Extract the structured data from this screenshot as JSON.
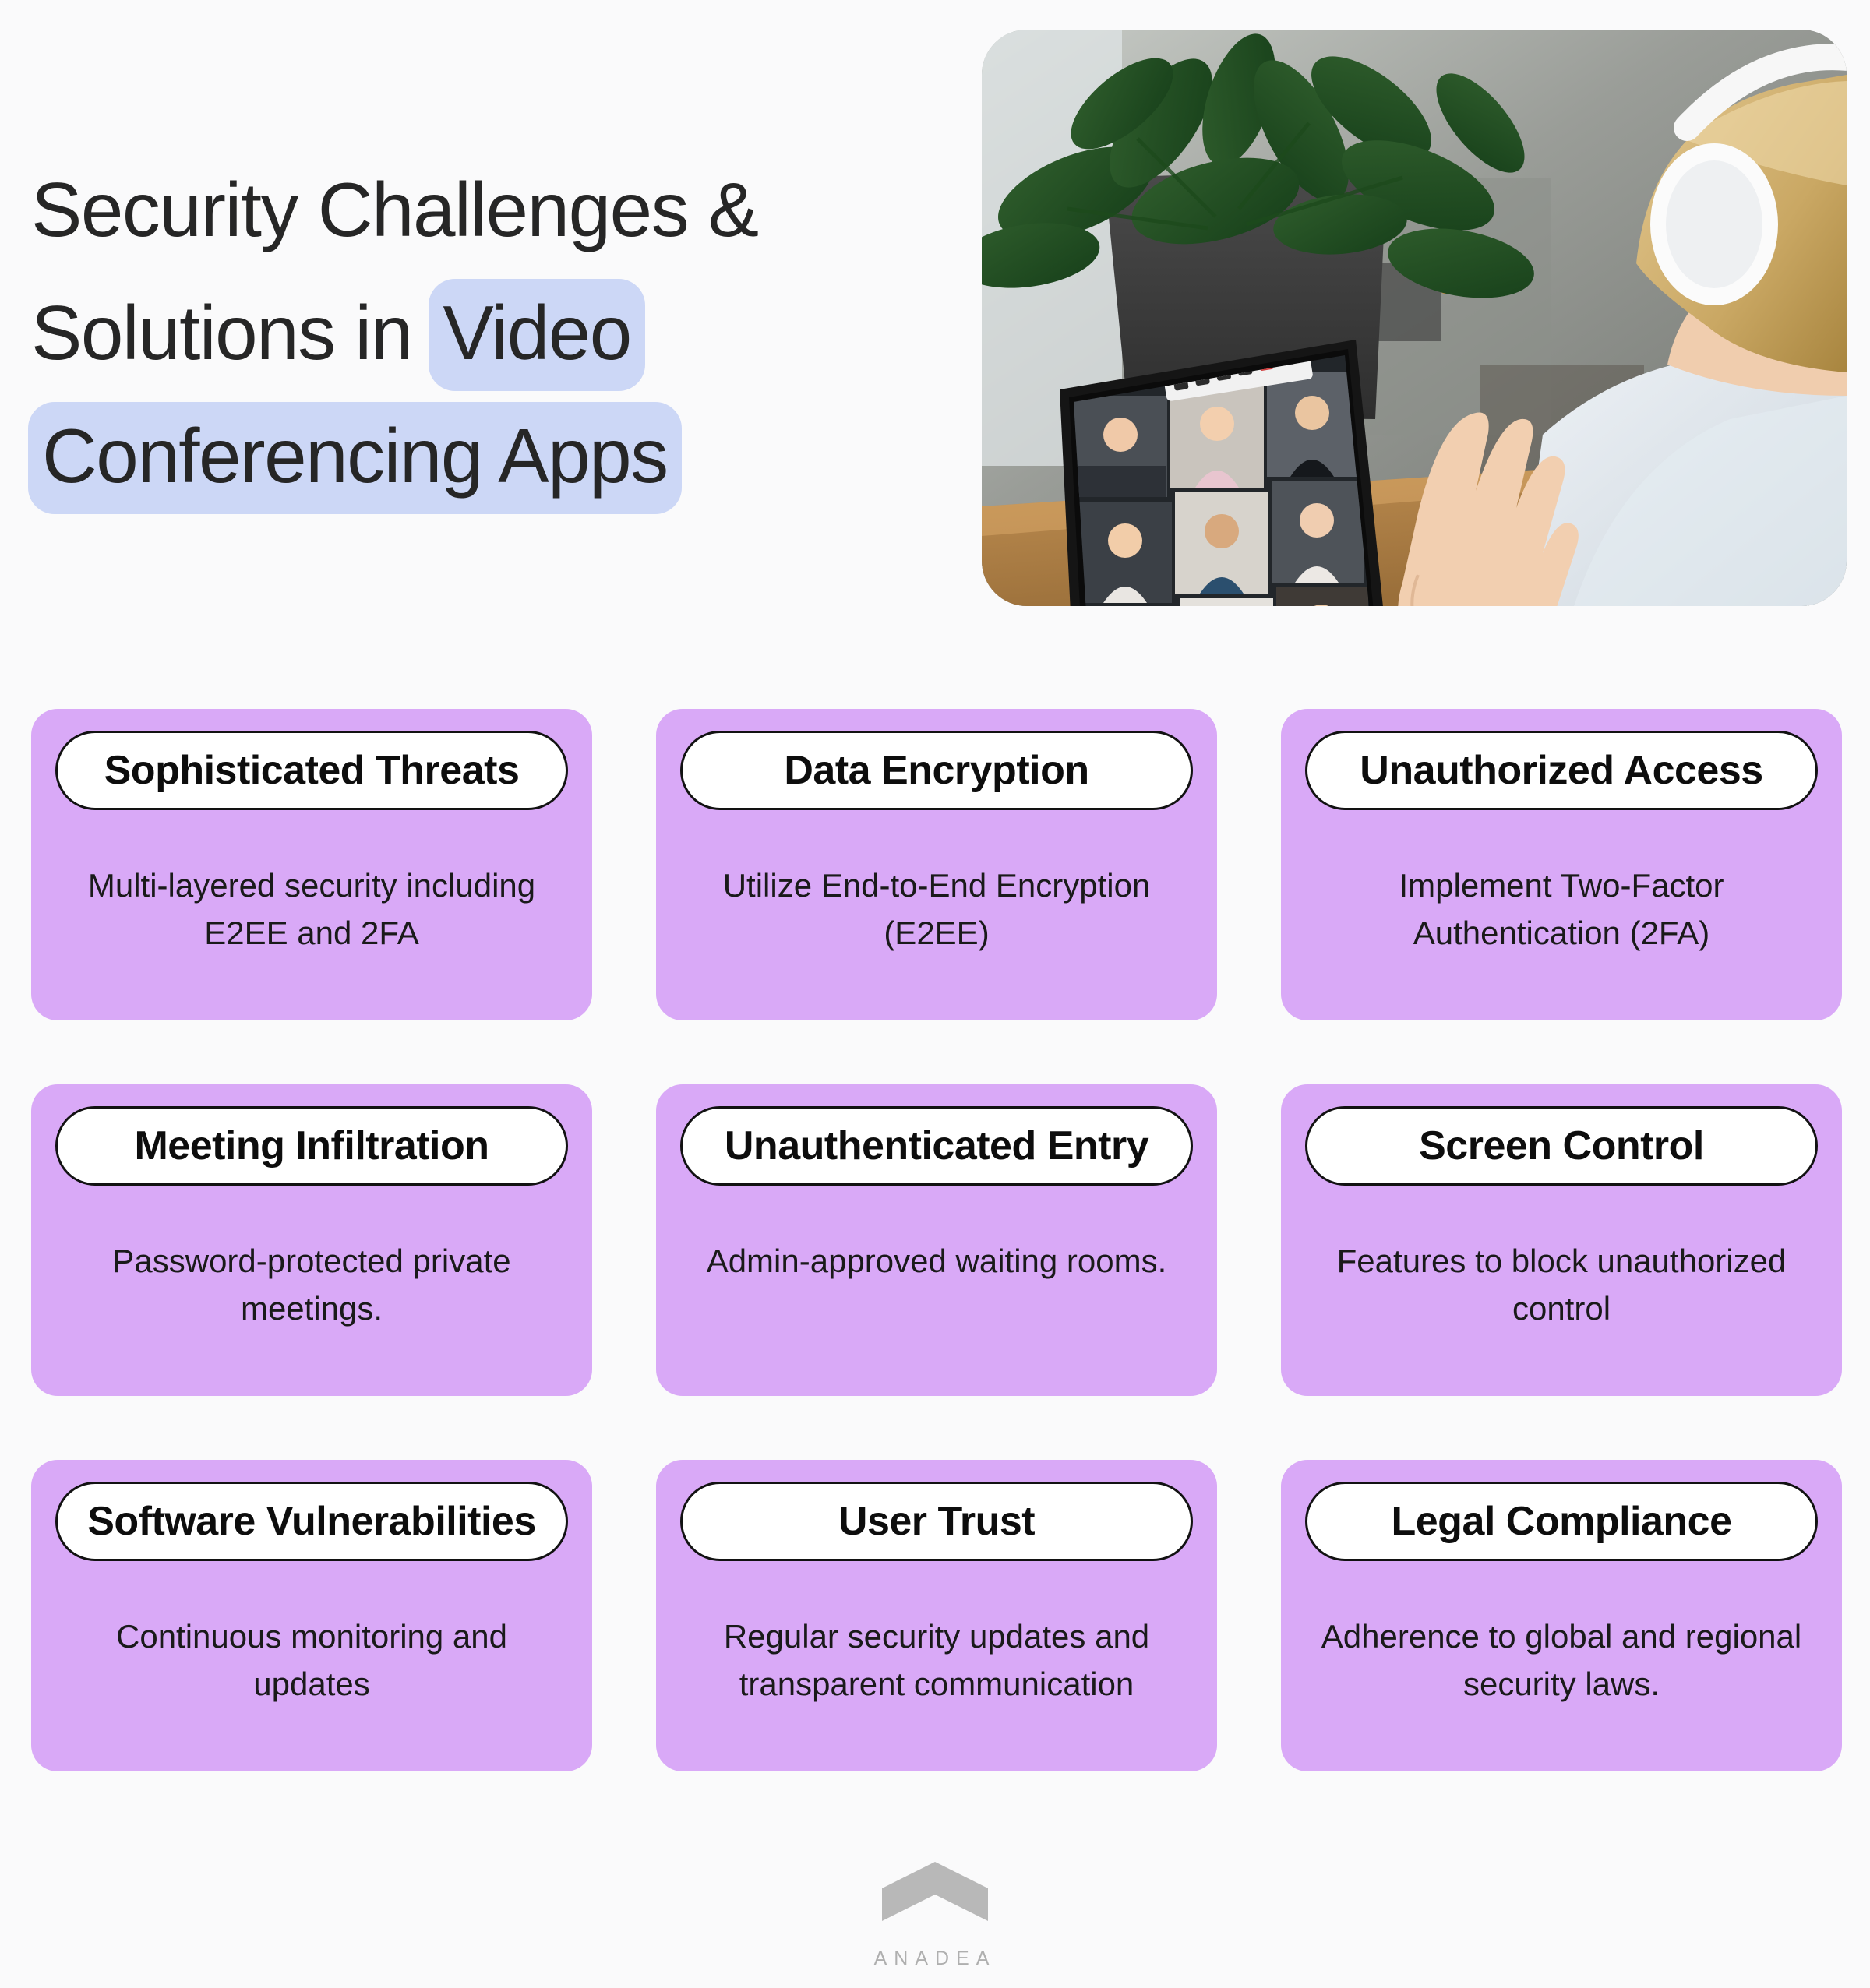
{
  "page": {
    "background_color": "#FAFAFB"
  },
  "hero": {
    "title_lines": [
      {
        "plain": "Security Challenges &",
        "highlight": ""
      },
      {
        "plain": "Solutions in ",
        "highlight": "Video"
      },
      {
        "plain": "",
        "highlight": "Conferencing Apps"
      }
    ],
    "title_full": "Security Challenges & Solutions in Video Conferencing Apps",
    "highlight_color": "#CCD7F6",
    "title_color": "#262626",
    "image": {
      "name": "video-conference-hero-photo",
      "alt": "Woman wearing white headphones sitting at a wooden desk waving at a tablet showing a nine-person video conference grid, with a large leafy plant in a dark pot behind her",
      "participant_grid": "3x3"
    }
  },
  "cards": [
    {
      "title": "Sophisticated Threats",
      "description": "Multi-layered security including E2EE and 2FA"
    },
    {
      "title": "Data Encryption",
      "description": "Utilize End-to-End Encryption (E2EE)"
    },
    {
      "title": "Unauthorized Access",
      "description": "Implement Two-Factor Authentication (2FA)"
    },
    {
      "title": "Meeting Infiltration",
      "description": "Password-protected private meetings."
    },
    {
      "title": "Unauthenticated Entry",
      "description": "Admin-approved waiting rooms."
    },
    {
      "title": "Screen Control",
      "description": "Features to block unauthorized control"
    },
    {
      "title": "Software Vulnerabilities",
      "description": "Continuous monitoring and updates"
    },
    {
      "title": "User Trust",
      "description": "Regular security updates and transparent communication"
    },
    {
      "title": "Legal Compliance",
      "description": "Adherence to global and regional security laws."
    }
  ],
  "card_style": {
    "background_color": "#D9A9F7",
    "pill_background": "#FFFFFF",
    "pill_border": "#121212",
    "text_color": "#1A1A1A"
  },
  "footer": {
    "brand": "ANADEA",
    "logo_icon": "chevron-up-mark",
    "logo_color": "#B8B8B8"
  }
}
